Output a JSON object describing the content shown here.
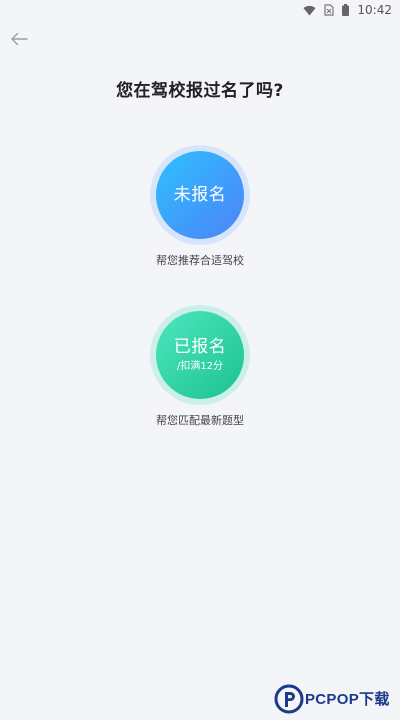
{
  "status_bar": {
    "time": "10:42"
  },
  "header": {
    "back_icon": "arrow-left-icon"
  },
  "question": "您在驾校报过名了吗?",
  "options": [
    {
      "label": "未报名",
      "subtext": "",
      "caption": "帮您推荐合适驾校",
      "color": "#3d9ff9"
    },
    {
      "label": "已报名",
      "subtext": "/扣满12分",
      "caption": "帮您匹配最新题型",
      "color": "#2dd4a6"
    }
  ],
  "watermark": {
    "text": "PCPOP下载"
  }
}
